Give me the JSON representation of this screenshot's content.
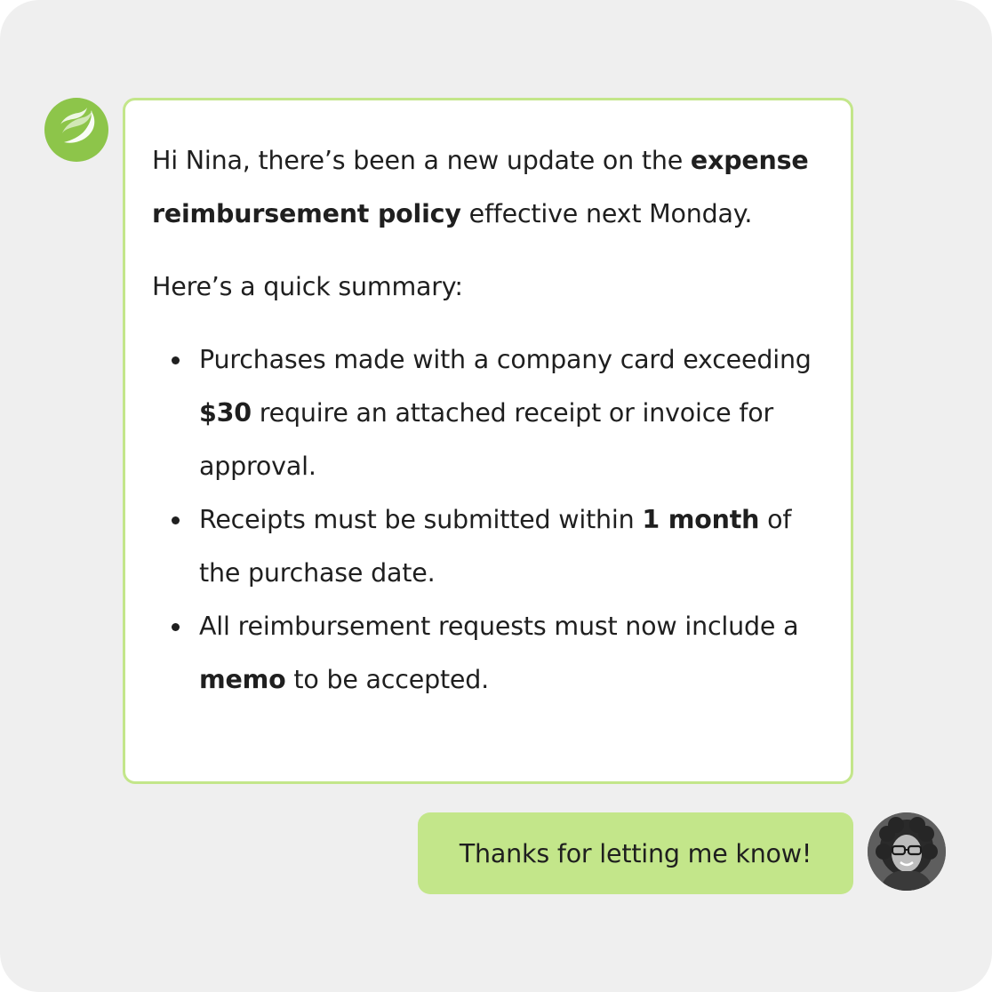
{
  "bot": {
    "avatar_icon": "leaf-logo-icon",
    "message": {
      "p1": {
        "greeting": "Hi Nina, there’s been a new update on the",
        "bold": "expense reimbursement policy",
        "tail": "effective next Monday."
      },
      "p2": "Here’s a quick summary:",
      "bullets": [
        {
          "pre": "Purchases made with a company card exceeding",
          "bold": "$30",
          "post": "require an attached receipt or invoice for approval."
        },
        {
          "pre": "Receipts must be submitted within",
          "bold": "1 month",
          "post": "of the purchase date."
        },
        {
          "pre": "All reimbursement requests must now include a",
          "bold": "memo",
          "post": "to be accepted."
        }
      ]
    }
  },
  "user": {
    "avatar_icon": "user-photo-avatar",
    "message": "Thanks for letting me know!"
  },
  "colors": {
    "background": "#efefef",
    "brand_green": "#8dc54a",
    "bubble_border": "#c3e68a",
    "user_bubble": "#c3e68a",
    "text": "#1f1f1f"
  }
}
